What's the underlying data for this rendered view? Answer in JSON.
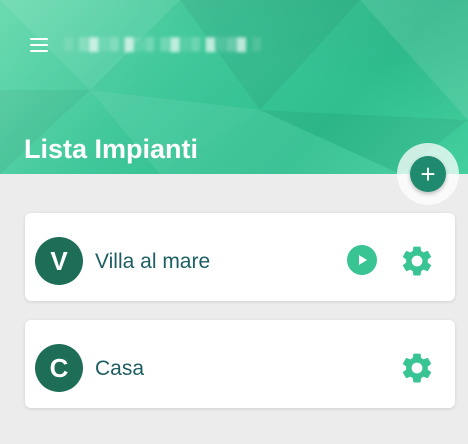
{
  "header": {
    "subtitle": "░ ▒▓░▒ ▓░▒ ▒▓░▒ ▓░▒▓ ░",
    "title": "Lista Impianti"
  },
  "fab": {
    "label": "+"
  },
  "impianti": [
    {
      "initial": "V",
      "name": "Villa al mare",
      "has_play": true
    },
    {
      "initial": "C",
      "name": "Casa",
      "has_play": false
    }
  ],
  "colors": {
    "header_gradient": "#3fc79a",
    "accent": "#38c493",
    "avatar": "#1e6e57",
    "fab": "#1f8a6e",
    "text": "#1d5e63"
  },
  "icons": [
    "menu-icon",
    "plus-icon",
    "play-icon",
    "gear-icon"
  ]
}
